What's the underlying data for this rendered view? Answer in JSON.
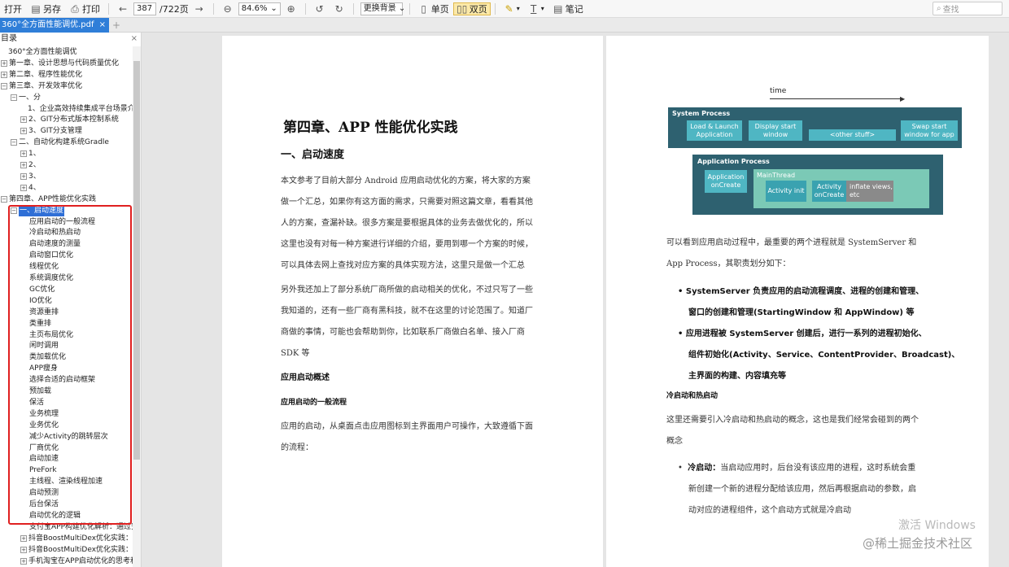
{
  "toolbar": {
    "open": "打开",
    "saveas": "另存",
    "print": "打印",
    "page_current": "387",
    "page_total": "/722页",
    "zoom": "84.6%",
    "background": "更换背景",
    "single": "单页",
    "double": "双页",
    "notes": "笔记",
    "search_placeholder": "查找"
  },
  "tab": {
    "title": "360°全方面性能调优.pdf",
    "close": "×",
    "add": "+"
  },
  "sidebar": {
    "header": "目录",
    "close": "×",
    "items": [
      {
        "label": "360°全方面性能调优",
        "indent": 0,
        "exp": ""
      },
      {
        "label": "第一章、设计思想与代码质量优化",
        "indent": 0,
        "exp": "+"
      },
      {
        "label": "第二章、程序性能优化",
        "indent": 0,
        "exp": "+"
      },
      {
        "label": "第三章、开发效率优化",
        "indent": 0,
        "exp": "-"
      },
      {
        "label": "一、分",
        "indent": 1,
        "exp": "-"
      },
      {
        "label": "1、企业高效持续集成平台场景介绍",
        "indent": 2,
        "exp": ""
      },
      {
        "label": "2、GIT分布式版本控制系统",
        "indent": 2,
        "exp": "+"
      },
      {
        "label": "3、GIT分支管理",
        "indent": 2,
        "exp": "+"
      },
      {
        "label": "二、自动化构建系统Gradle",
        "indent": 1,
        "exp": "-"
      },
      {
        "label": "1、",
        "indent": 2,
        "exp": "+"
      },
      {
        "label": "2、",
        "indent": 2,
        "exp": "+"
      },
      {
        "label": "3、",
        "indent": 2,
        "exp": "+"
      },
      {
        "label": "4、",
        "indent": 2,
        "exp": "+"
      },
      {
        "label": "第四章、APP性能优化实践",
        "indent": 0,
        "exp": "-"
      },
      {
        "label": "一、启动速度",
        "indent": 1,
        "exp": "-",
        "selected": true
      },
      {
        "label": "应用启动的一般流程",
        "indent": 3,
        "exp": ""
      },
      {
        "label": "冷启动和热启动",
        "indent": 3,
        "exp": ""
      },
      {
        "label": "启动速度的测量",
        "indent": 3,
        "exp": ""
      },
      {
        "label": "启动窗口优化",
        "indent": 3,
        "exp": ""
      },
      {
        "label": "线程优化",
        "indent": 3,
        "exp": ""
      },
      {
        "label": "系统调度优化",
        "indent": 3,
        "exp": ""
      },
      {
        "label": "GC优化",
        "indent": 3,
        "exp": ""
      },
      {
        "label": "IO优化",
        "indent": 3,
        "exp": ""
      },
      {
        "label": "资源重排",
        "indent": 3,
        "exp": ""
      },
      {
        "label": "类重排",
        "indent": 3,
        "exp": ""
      },
      {
        "label": "主页布局优化",
        "indent": 3,
        "exp": ""
      },
      {
        "label": "闲时调用",
        "indent": 3,
        "exp": ""
      },
      {
        "label": "类加载优化",
        "indent": 3,
        "exp": ""
      },
      {
        "label": "APP瘦身",
        "indent": 3,
        "exp": ""
      },
      {
        "label": "选择合适的启动框架",
        "indent": 3,
        "exp": ""
      },
      {
        "label": "预加载",
        "indent": 3,
        "exp": ""
      },
      {
        "label": "保活",
        "indent": 3,
        "exp": ""
      },
      {
        "label": "业务梳理",
        "indent": 3,
        "exp": ""
      },
      {
        "label": "业务优化",
        "indent": 3,
        "exp": ""
      },
      {
        "label": "减少Activity的跳转层次",
        "indent": 3,
        "exp": ""
      },
      {
        "label": "厂商优化",
        "indent": 3,
        "exp": ""
      },
      {
        "label": "启动加速",
        "indent": 3,
        "exp": ""
      },
      {
        "label": "PreFork",
        "indent": 3,
        "exp": ""
      },
      {
        "label": "主线程、渲染线程加速",
        "indent": 3,
        "exp": ""
      },
      {
        "label": "启动预测",
        "indent": 3,
        "exp": ""
      },
      {
        "label": "后台保活",
        "indent": 3,
        "exp": ""
      },
      {
        "label": "启动优化的逻辑",
        "indent": 3,
        "exp": ""
      },
      {
        "label": "支付宝APP构建优化解析：通过安装包重排布",
        "indent": 3,
        "exp": ""
      },
      {
        "label": "抖音BoostMultiDex优化实践：Android低版本",
        "indent": 2,
        "exp": "+"
      },
      {
        "label": "抖音BoostMultiDex优化实践：Android低版本",
        "indent": 2,
        "exp": "+"
      },
      {
        "label": "手机淘宝在APP启动优化的思考和实践",
        "indent": 2,
        "exp": "+"
      }
    ]
  },
  "page1": {
    "chapter": "第四章、APP 性能优化实践",
    "section": "一、启动速度",
    "para1": [
      "本文参考了目前大部分 Android 应用启动优化的方案，将大家的方案",
      "做一个汇总，如果你有这方面的需求，只需要对照这篇文章，看看其他",
      "人的方案，查漏补缺。很多方案是要根据具体的业务去做优化的，所以",
      "这里也没有对每一种方案进行详细的介绍，要用到哪一个方案的时候，",
      "可以具体去网上查找对应方案的具体实现方法，这里只是做一个汇总"
    ],
    "para2": [
      "另外我还加上了部分系统厂商所做的启动相关的优化，不过只写了一些",
      "我知道的，还有一些厂商有黑科技，就不在这里的讨论范围了。知道厂",
      "商做的事情，可能也会帮助到你，比如联系厂商做白名单、接入厂商",
      "SDK 等"
    ],
    "sub1": "应用启动概述",
    "sub2": "应用启动的一般流程",
    "para3": [
      "应用的启动，从桌面点击应用图标到主界面用户可操作，大致遵循下面",
      "的流程："
    ]
  },
  "page2": {
    "diagram": {
      "time": "time",
      "system_process": "System Process",
      "load_launch": "Load & Launch Application",
      "display_start": "Display start window",
      "other_stuff": "<other stuff>",
      "swap_start": "Swap start window for app",
      "app_process": "Application Process",
      "app_oncreate": "Application onCreate",
      "main_thread": "MainThread",
      "activity_init": "Activity init",
      "activity_oncreate": "Activity onCreate",
      "inflate": "inflate views, etc"
    },
    "para1": [
      "可以看到应用启动过程中，最重要的两个进程就是 SystemServer 和",
      "App Process，其职责划分如下："
    ],
    "bullets1": [
      "SystemServer 负责应用的启动流程调度、进程的创建和管理、",
      "窗口的创建和管理(StartingWindow 和 AppWindow) 等",
      "应用进程被 SystemServer 创建后，进行一系列的进程初始化、",
      "组件初始化(Activity、Service、ContentProvider、Broadcast)、",
      "主界面的构建、内容填充等"
    ],
    "sub": "冷启动和热启动",
    "para2": [
      "这里还需要引入冷启动和热启动的概念，这也是我们经常会碰到的两个",
      "概念"
    ],
    "cold_label": "冷启动：",
    "cold": [
      "当启动应用时，后台没有该应用的进程，这时系统会重",
      "新创建一个新的进程分配给该应用，然后再根据启动的参数，启",
      "动对应的进程组件，这个启动方式就是冷启动"
    ]
  },
  "watermark": {
    "activate": "激活 Windows",
    "community": "@稀土掘金技术社区"
  }
}
